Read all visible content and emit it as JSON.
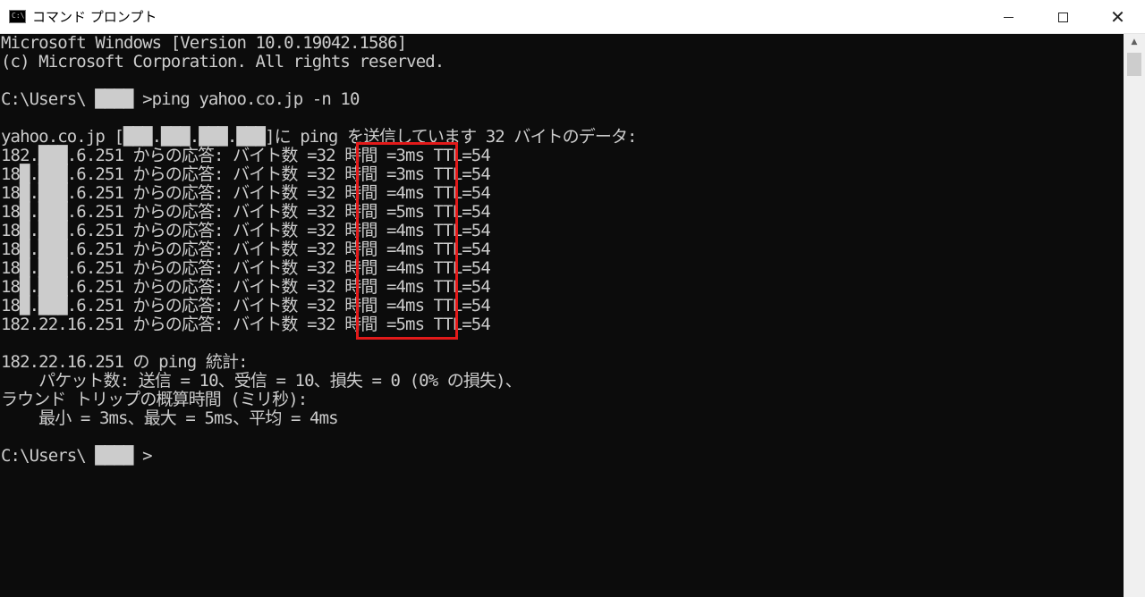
{
  "window": {
    "title": "コマンド プロンプト",
    "icon": "cmd-icon",
    "icon_text": "C:\\",
    "controls": {
      "minimize": "—",
      "maximize": "☐",
      "close": "✕"
    }
  },
  "console": {
    "lines": [
      "Microsoft Windows [Version 10.0.19042.1586]",
      "(c) Microsoft Corporation. All rights reserved.",
      "",
      "C:\\Users\\ ████ >ping yahoo.co.jp -n 10",
      "",
      "yahoo.co.jp [███.███.███.███]に ping を送信しています 32 バイトのデータ:",
      "182.███.6.251 からの応答: バイト数 =32 時間 =3ms TTL=54",
      "18█.███.6.251 からの応答: バイト数 =32 時間 =3ms TTL=54",
      "18█.███.6.251 からの応答: バイト数 =32 時間 =4ms TTL=54",
      "18█.███.6.251 からの応答: バイト数 =32 時間 =5ms TTL=54",
      "18█.███.6.251 からの応答: バイト数 =32 時間 =4ms TTL=54",
      "18█.███.6.251 からの応答: バイト数 =32 時間 =4ms TTL=54",
      "18█.███.6.251 からの応答: バイト数 =32 時間 =4ms TTL=54",
      "18█.███.6.251 からの応答: バイト数 =32 時間 =4ms TTL=54",
      "18█.███.6.251 からの応答: バイト数 =32 時間 =4ms TTL=54",
      "182.22.16.251 からの応答: バイト数 =32 時間 =5ms TTL=54",
      "",
      "182.22.16.251 の ping 統計:",
      "    パケット数: 送信 = 10、受信 = 10、損失 = 0 (0% の損失)、",
      "ラウンド トリップの概算時間 (ミリ秒):",
      "    最小 = 3ms、最大 = 5ms、平均 = 4ms",
      "",
      "C:\\Users\\ ████ >"
    ],
    "text_color": "#cccccc",
    "background": "#0c0c0c",
    "highlight_color": "#e21a1a"
  }
}
